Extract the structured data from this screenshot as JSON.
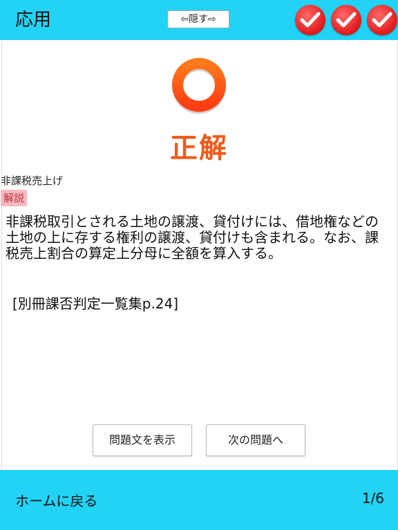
{
  "header": {
    "title": "応用",
    "hide_button": "⇦隠す⇨",
    "check_icons": [
      "check-icon",
      "check-icon",
      "check-icon"
    ]
  },
  "result": {
    "icon": "correct-circle-icon",
    "label": "正解"
  },
  "question": {
    "category": "非課税売上げ",
    "explanation_tag": "解説",
    "explanation": "非課税取引とされる土地の譲渡、貸付けには、借地権などの土地の上に存する権利の譲渡、貸付けも含まれる。なお、課税売上割合の算定上分母に全額を算入する。",
    "reference": "[別冊課否判定一覧集p.24]"
  },
  "buttons": {
    "show_question": "問題文を表示",
    "next_question": "次の問題へ"
  },
  "footer": {
    "home": "ホームに戻る",
    "page": "1/6"
  },
  "colors": {
    "bar": "#22d3f5",
    "accent_orange": "#f15a1a",
    "check_red": "#e01919",
    "tag_bg": "#f7b9c0"
  }
}
